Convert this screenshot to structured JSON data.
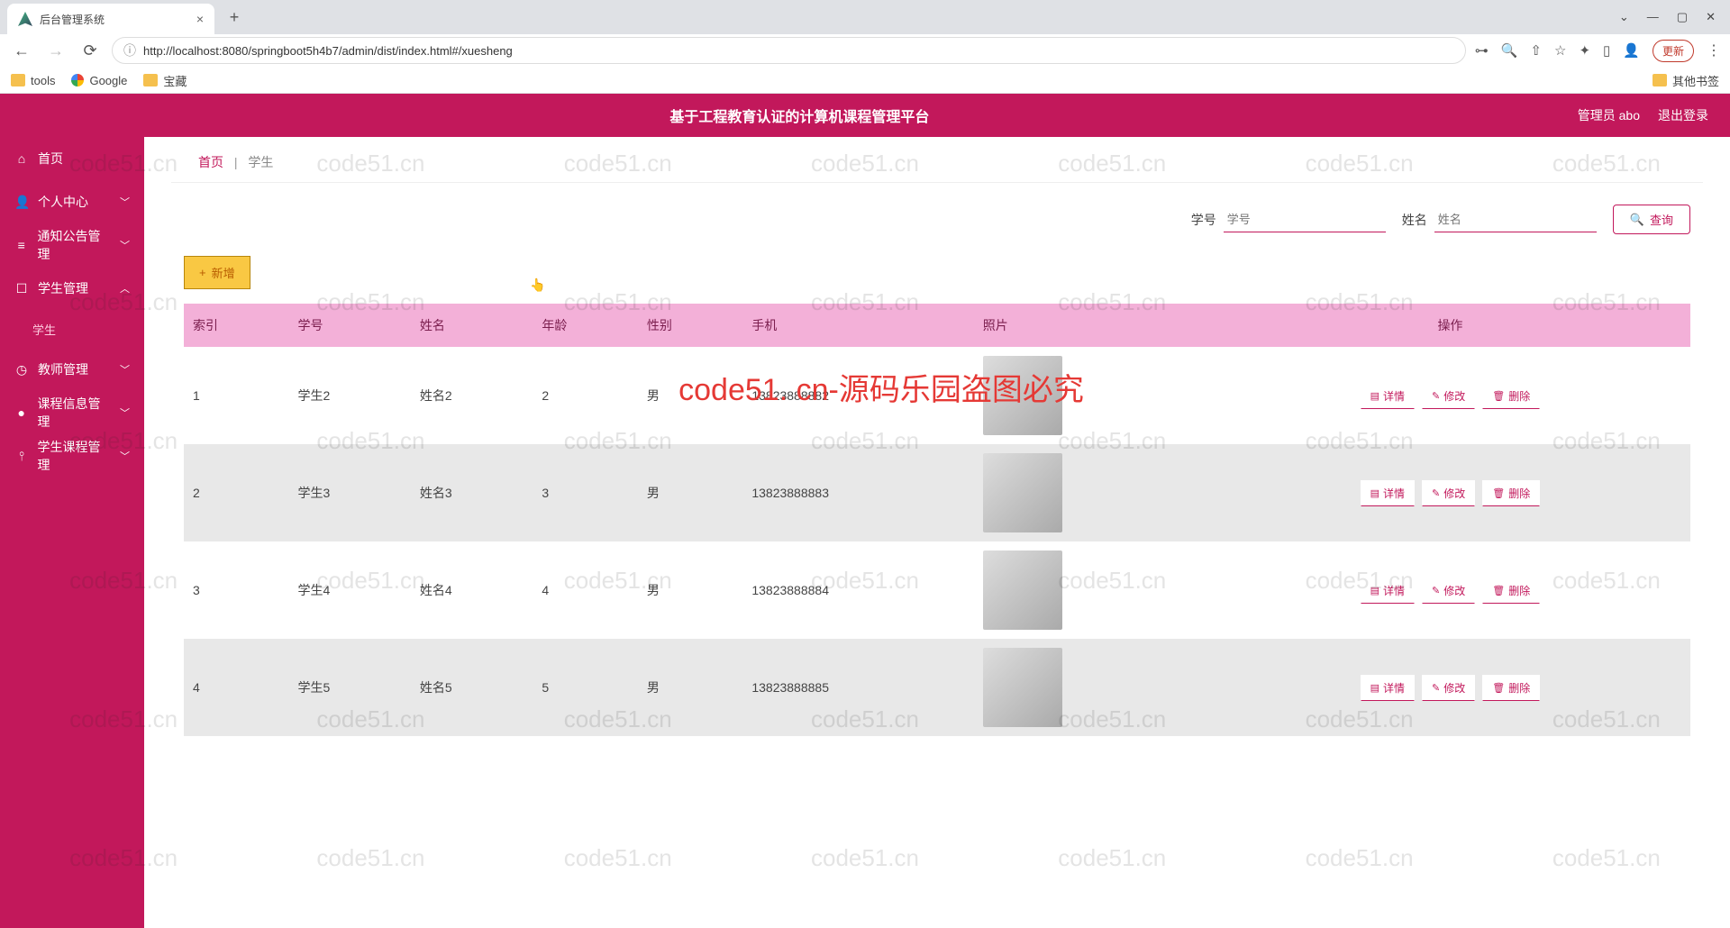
{
  "browser": {
    "tab_title": "后台管理系统",
    "url": "http://localhost:8080/springboot5h4b7/admin/dist/index.html#/xuesheng",
    "update_label": "更新",
    "bookmarks": {
      "tools": "tools",
      "google": "Google",
      "treasure": "宝藏",
      "other": "其他书签"
    }
  },
  "header": {
    "title": "基于工程教育认证的计算机课程管理平台",
    "user": "管理员 abo",
    "logout": "退出登录"
  },
  "sidebar": {
    "home": "首页",
    "personal": "个人中心",
    "notice": "通知公告管理",
    "student_mgmt": "学生管理",
    "student": "学生",
    "teacher": "教师管理",
    "course": "课程信息管理",
    "stu_course": "学生课程管理"
  },
  "breadcrumb": {
    "home": "首页",
    "current": "学生"
  },
  "search": {
    "sno_label": "学号",
    "sno_placeholder": "学号",
    "name_label": "姓名",
    "name_placeholder": "姓名",
    "button": "查询"
  },
  "add_button": "新增",
  "columns": {
    "index": "索引",
    "sno": "学号",
    "name": "姓名",
    "age": "年龄",
    "gender": "性别",
    "phone": "手机",
    "photo": "照片",
    "ops": "操作"
  },
  "ops": {
    "detail": "详情",
    "edit": "修改",
    "delete": "删除"
  },
  "rows": [
    {
      "idx": "1",
      "sno": "学生2",
      "name": "姓名2",
      "age": "2",
      "gender": "男",
      "phone": "13823888882"
    },
    {
      "idx": "2",
      "sno": "学生3",
      "name": "姓名3",
      "age": "3",
      "gender": "男",
      "phone": "13823888883"
    },
    {
      "idx": "3",
      "sno": "学生4",
      "name": "姓名4",
      "age": "4",
      "gender": "男",
      "phone": "13823888884"
    },
    {
      "idx": "4",
      "sno": "学生5",
      "name": "姓名5",
      "age": "5",
      "gender": "男",
      "phone": "13823888885"
    }
  ],
  "watermark": {
    "text": "code51.cn",
    "center": "code51. cn-源码乐园盗图必究"
  }
}
